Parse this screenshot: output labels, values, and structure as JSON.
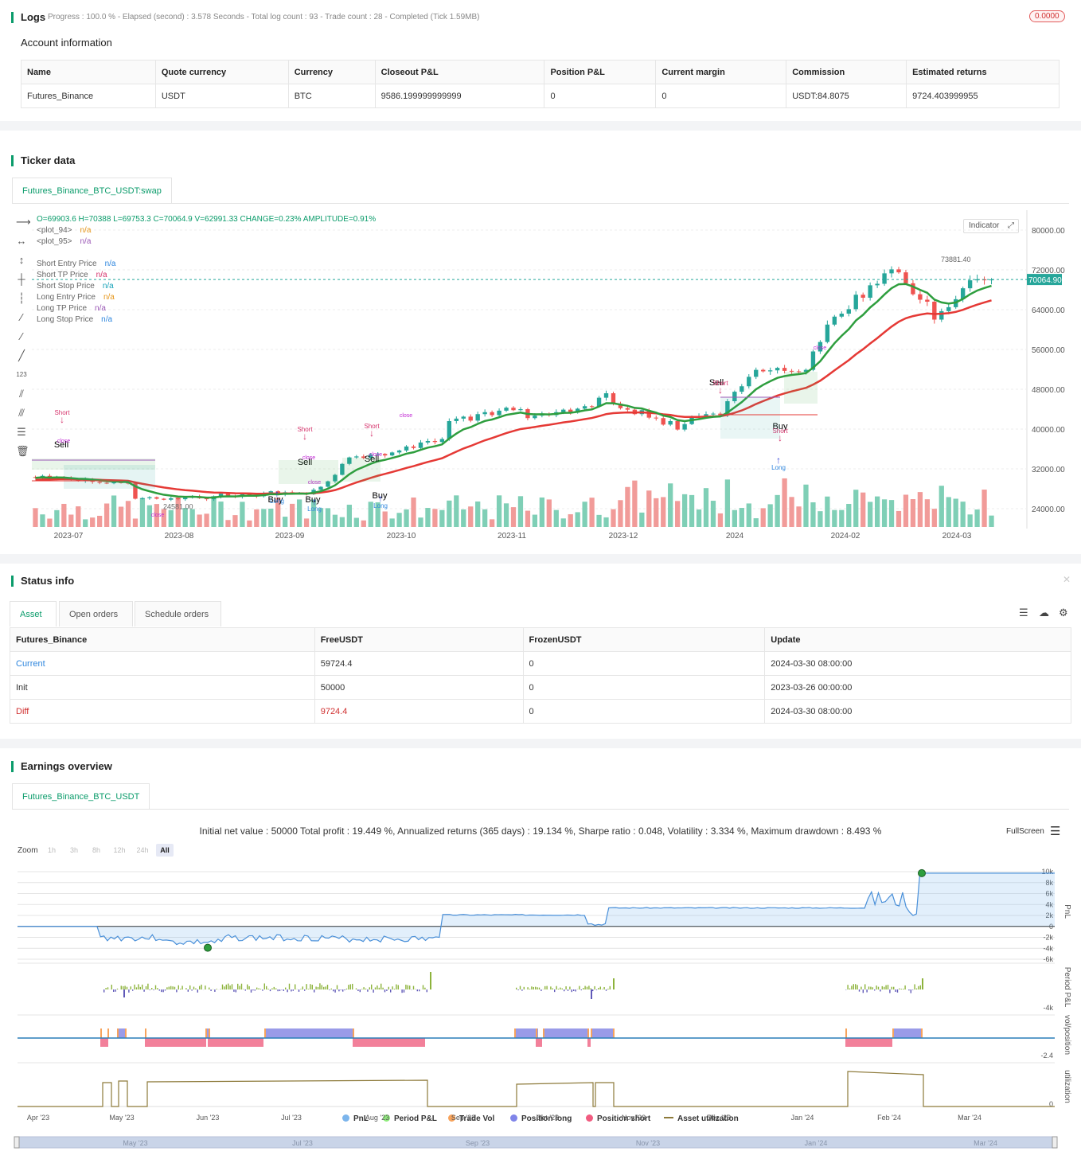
{
  "logs": {
    "title": "Logs",
    "summary": "Progress : 100.0 % - Elapsed (second) : 3.578  Seconds - Total log count : 93 - Trade count : 28 - Completed (Tick 1.59MB)",
    "badge": "0.0000"
  },
  "account": {
    "heading": "Account information",
    "columns": [
      "Name",
      "Quote currency",
      "Currency",
      "Closeout P&L",
      "Position P&L",
      "Current margin",
      "Commission",
      "Estimated returns"
    ],
    "row": [
      "Futures_Binance",
      "USDT",
      "BTC",
      "9586.199999999999",
      "0",
      "0",
      "USDT:84.8075",
      "9724.403999955"
    ]
  },
  "ticker": {
    "title": "Ticker data",
    "tab": "Futures_Binance_BTC_USDT:swap",
    "ohlc": "O=69903.6 H=70388 L=69753.3 C=70064.9 V=62991.33 CHANGE=0.23% AMPLITUDE=0.91%",
    "indicator_button": "Indicator",
    "legend": [
      {
        "label": "<plot_94>",
        "value": "n/a",
        "color": "#e6961a"
      },
      {
        "label": "<plot_95>",
        "value": "n/a",
        "color": "#9b59b6"
      },
      {
        "label": "Short Entry Price",
        "value": "n/a",
        "color": "#2e86de"
      },
      {
        "label": "Short TP Price",
        "value": "n/a",
        "color": "#d6336c"
      },
      {
        "label": "Short Stop Price",
        "value": "n/a",
        "color": "#17a2b8"
      },
      {
        "label": "Long Entry Price",
        "value": "n/a",
        "color": "#e6961a"
      },
      {
        "label": "Long TP Price",
        "value": "n/a",
        "color": "#9b59b6"
      },
      {
        "label": "Long Stop Price",
        "value": "n/a",
        "color": "#2e86de"
      }
    ],
    "price_axis": [
      "80000.00",
      "72000.00",
      "64000.00",
      "56000.00",
      "48000.00",
      "40000.00",
      "32000.00",
      "24000.00"
    ],
    "current_price": "70064.90",
    "high_label": "73881.40",
    "low_label": "24581.00",
    "time_axis": [
      "2023-07",
      "2023-08",
      "2023-09",
      "2023-10",
      "2023-11",
      "2023-12",
      "2024",
      "2024-02",
      "2024-03"
    ],
    "signals": {
      "sell": "Sell",
      "buy": "Buy",
      "short": "Short",
      "long": "Long",
      "close": "close",
      "one": "1"
    }
  },
  "status": {
    "title": "Status info",
    "tabs": [
      "Asset",
      "Open orders",
      "Schedule orders"
    ],
    "columns": [
      "Futures_Binance",
      "FreeUSDT",
      "FrozenUSDT",
      "Update"
    ],
    "rows": [
      [
        "Current",
        "59724.4",
        "0",
        "2024-03-30 08:00:00"
      ],
      [
        "Init",
        "50000",
        "0",
        "2023-03-26 00:00:00"
      ],
      [
        "Diff",
        "9724.4",
        "0",
        "2024-03-30 08:00:00"
      ]
    ]
  },
  "earnings": {
    "title": "Earnings overview",
    "tab": "Futures_Binance_BTC_USDT",
    "summary": "Initial net value : 50000 Total profit : 19.449 %, Annualized returns (365 days) : 19.134 %, Sharpe ratio : 0.048, Volatility : 3.334 %, Maximum drawdown : 8.493 %",
    "fullscreen": "FullScreen",
    "zoom_label": "Zoom",
    "zoom_options": [
      "1h",
      "3h",
      "8h",
      "12h",
      "24h",
      "All"
    ],
    "pnl_axis": [
      "10k",
      "8k",
      "6k",
      "4k",
      "2k",
      "0",
      "-2k",
      "-4k",
      "-6k"
    ],
    "period_axis": "-4k",
    "vol_axis": "-2.4",
    "util_axis": "0",
    "right_labels": [
      "PnL",
      "Period P&L",
      "vol/position",
      "utilization"
    ],
    "time_axis": [
      "Apr '23",
      "May '23",
      "Jun '23",
      "Jul '23",
      "Aug '23",
      "Sep '23",
      "Oct '23",
      "Nov '23",
      "Dec '23",
      "Jan '24",
      "Feb '24",
      "Mar '24"
    ],
    "navigator_axis": [
      "May '23",
      "Jul '23",
      "Sep '23",
      "Nov '23",
      "Jan '24",
      "Mar '24"
    ],
    "legend": [
      {
        "label": "PnL",
        "color": "#7cb5ec"
      },
      {
        "label": "Period P&L",
        "color": "#90ed7d"
      },
      {
        "label": "Trade Vol",
        "color": "#f7a35c"
      },
      {
        "label": "Position long",
        "color": "#8085e9"
      },
      {
        "label": "Position short",
        "color": "#f15c80"
      },
      {
        "label": "Asset utilization",
        "color": "#8d7a3a"
      }
    ]
  },
  "chart_data": [
    {
      "type": "candlestick",
      "title": "",
      "ylim": [
        20000,
        84000
      ],
      "x_range": [
        "2023-06-20",
        "2024-03-30"
      ],
      "closes": [
        30200,
        30600,
        30100,
        30400,
        30200,
        29800,
        29600,
        29900,
        29400,
        29200,
        29100,
        29300,
        29200,
        29100,
        26000,
        26100,
        26300,
        26000,
        25800,
        26100,
        25900,
        26200,
        26500,
        26100,
        25900,
        26300,
        27000,
        26600,
        26400,
        26900,
        26800,
        26500,
        27100,
        27500,
        26800,
        27300,
        27000,
        27200,
        26900,
        27800,
        28400,
        29500,
        30800,
        33000,
        34300,
        34500,
        34200,
        34900,
        35000,
        34700,
        35300,
        35700,
        36500,
        36200,
        37300,
        37600,
        37400,
        38000,
        41600,
        42100,
        42500,
        41700,
        43000,
        43400,
        42800,
        43700,
        44300,
        43800,
        44000,
        42200,
        42700,
        43100,
        42800,
        43400,
        43900,
        43300,
        44100,
        44600,
        44500,
        46300,
        47200,
        45100,
        44200,
        43900,
        43000,
        43800,
        42300,
        42200,
        40900,
        41600,
        39900,
        41000,
        42400,
        42600,
        43000,
        43100,
        42800,
        45600,
        47500,
        48600,
        50500,
        51900,
        51600,
        51800,
        52300,
        51700,
        51600,
        51500,
        51900,
        55600,
        57500,
        61000,
        62600,
        63200,
        64100,
        67000,
        66400,
        68900,
        69200,
        71300,
        72100,
        71500,
        69300,
        67100,
        66000,
        65600,
        62000,
        63700,
        64500,
        66100,
        68300,
        69900,
        70100,
        69900,
        70064
      ]
    },
    {
      "type": "line",
      "title": "",
      "series": [
        {
          "name": "PnL",
          "ylim": [
            -6000,
            10000
          ]
        }
      ],
      "x_range": [
        "2023-03-26",
        "2024-03-30"
      ],
      "final_value": 9724.4
    }
  ]
}
